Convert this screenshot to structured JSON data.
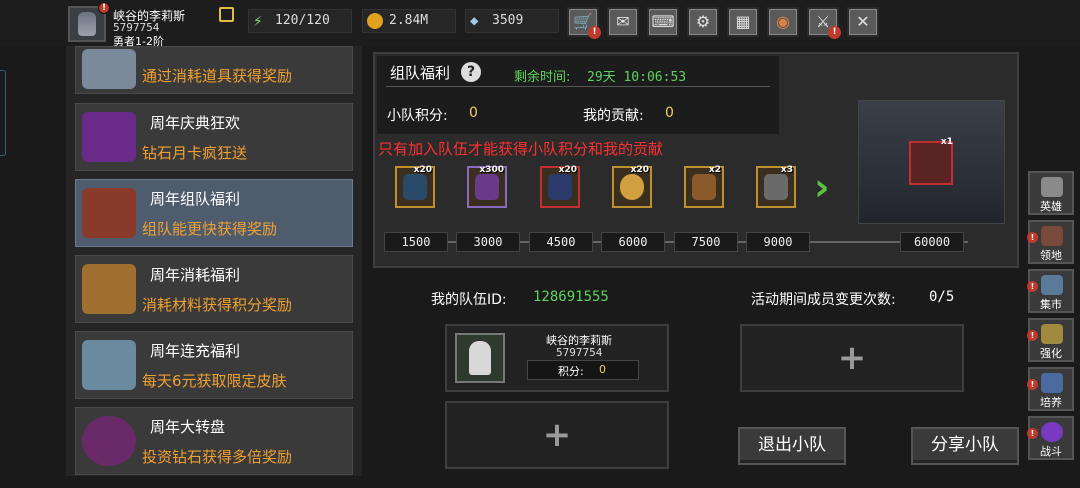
{
  "player": {
    "name": "峡谷的李莉斯",
    "id": "5797754",
    "rank": "勇者1-2阶",
    "alert": "!"
  },
  "resources": {
    "energy": "120/120",
    "gold": "2.84M",
    "diamond": "3509"
  },
  "toolbar": {
    "icons": [
      "shop-cart-icon",
      "mail-icon",
      "gamepad-icon",
      "gear-icon",
      "gift-icon",
      "color-wheel-icon",
      "locked-sword-icon",
      "crossed-swords-icon"
    ],
    "alert": "!"
  },
  "events": [
    {
      "title": "",
      "subtitle": "通过消耗道具获得奖励",
      "icon": "stone-icon",
      "color": "#7a8a9a"
    },
    {
      "title": "周年庆典狂欢",
      "subtitle": "钻石月卡疯狂送",
      "icon": "purple-card-icon",
      "color": "#6a2a8a"
    },
    {
      "title": "周年组队福利",
      "subtitle": "组队能更快获得奖励",
      "icon": "treasure-chest-icon",
      "color": "#8a3a2a"
    },
    {
      "title": "周年消耗福利",
      "subtitle": "消耗材料获得积分奖励",
      "icon": "gold-chest-icon",
      "color": "#a07030"
    },
    {
      "title": "周年连充福利",
      "subtitle": "每天6元获取限定皮肤",
      "icon": "crystal-icon",
      "color": "#6a8aa0"
    },
    {
      "title": "周年大转盘",
      "subtitle": "投资钻石获得多倍奖励",
      "icon": "wheel-icon",
      "color": "#6a2a6a"
    }
  ],
  "team_benefit": {
    "title": "组队福利",
    "remain_label": "剩余时间:",
    "remain_value": "29天 10:06:53",
    "score_label": "小队积分:",
    "score_value": "0",
    "contrib_label": "我的贡献:",
    "contrib_value": "0",
    "warning": "只有加入队伍才能获得小队积分和我的贡献",
    "rewards": [
      {
        "count": "x20",
        "icon": "lightning-icon",
        "color": "#2a4a6a"
      },
      {
        "count": "x300",
        "icon": "fire-orb-icon",
        "color": "#6a3a8a"
      },
      {
        "count": "x20",
        "icon": "blue-gem-icon",
        "color": "#2a3a6a"
      },
      {
        "count": "x20",
        "icon": "egg-icon",
        "color": "#d0a040"
      },
      {
        "count": "x2",
        "icon": "scroll-icon",
        "color": "#8a5a2a"
      },
      {
        "count": "x3",
        "icon": "hammer-icon",
        "color": "#6a6a6a"
      }
    ],
    "milestones": [
      "1500",
      "3000",
      "4500",
      "6000",
      "7500",
      "9000",
      "60000"
    ],
    "final_reward_count": "x1"
  },
  "team": {
    "id_label": "我的队伍ID:",
    "id_value": "128691555",
    "change_label": "活动期间成员变更次数:",
    "change_value": "0/5",
    "member": {
      "name": "峡谷的李莉斯",
      "id": "5797754",
      "score_label": "积分:",
      "score_value": "0"
    },
    "plus": "+",
    "leave_button": "退出小队",
    "share_button": "分享小队"
  },
  "sidebar": [
    {
      "label": "英雄",
      "icon": "helmet-icon",
      "color": "#8a8a8a",
      "alert": false
    },
    {
      "label": "领地",
      "icon": "castle-icon",
      "color": "#7a4a3a",
      "alert": true
    },
    {
      "label": "集市",
      "icon": "market-icon",
      "color": "#5a7a9a",
      "alert": true
    },
    {
      "label": "强化",
      "icon": "enhance-icon",
      "color": "#a08a40",
      "alert": true
    },
    {
      "label": "培养",
      "icon": "potion-icon",
      "color": "#4a6aa0",
      "alert": true
    },
    {
      "label": "战斗",
      "icon": "portal-icon",
      "color": "#7a3ac0",
      "alert": true
    }
  ]
}
